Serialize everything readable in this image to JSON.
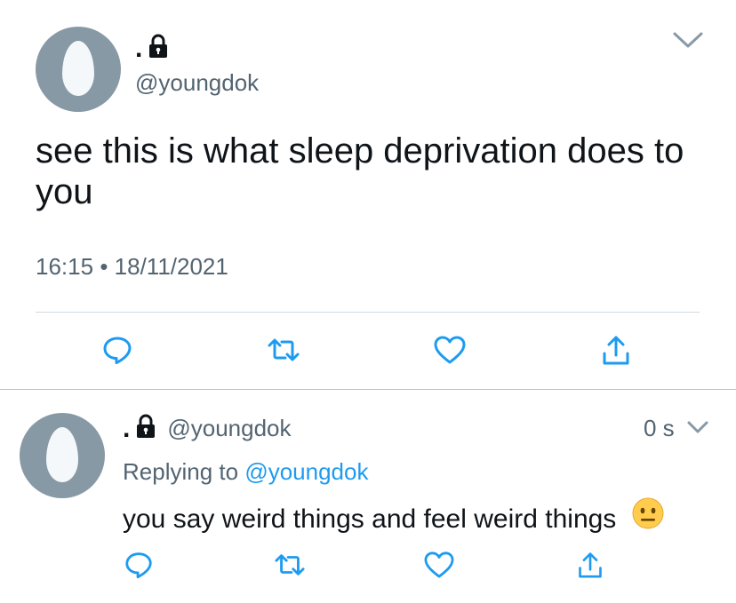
{
  "main_tweet": {
    "display_name": ".",
    "handle": "@youngdok",
    "text": "see this is what sleep deprivation does to you",
    "time": "16:15",
    "separator": "•",
    "date": "18/11/2021"
  },
  "reply_tweet": {
    "display_name": ".",
    "handle": "@youngdok",
    "time_ago": "0 s",
    "replying_to_label": "Replying to",
    "replying_to_handle": "@youngdok",
    "text": "you say weird things and feel weird things"
  },
  "icons": {
    "reply": "reply-icon",
    "retweet": "retweet-icon",
    "like": "heart-icon",
    "share": "share-icon",
    "lock": "lock-icon",
    "chevron": "chevron-down-icon",
    "emoji": "neutral-face-emoji"
  },
  "colors": {
    "text": "#0f1419",
    "secondary": "#536471",
    "link": "#1d9bf0",
    "icon": "#1d9bf0",
    "avatar_bg": "#8899a6",
    "avatar_egg": "#f5f8fa",
    "divider": "#cfd9de"
  }
}
